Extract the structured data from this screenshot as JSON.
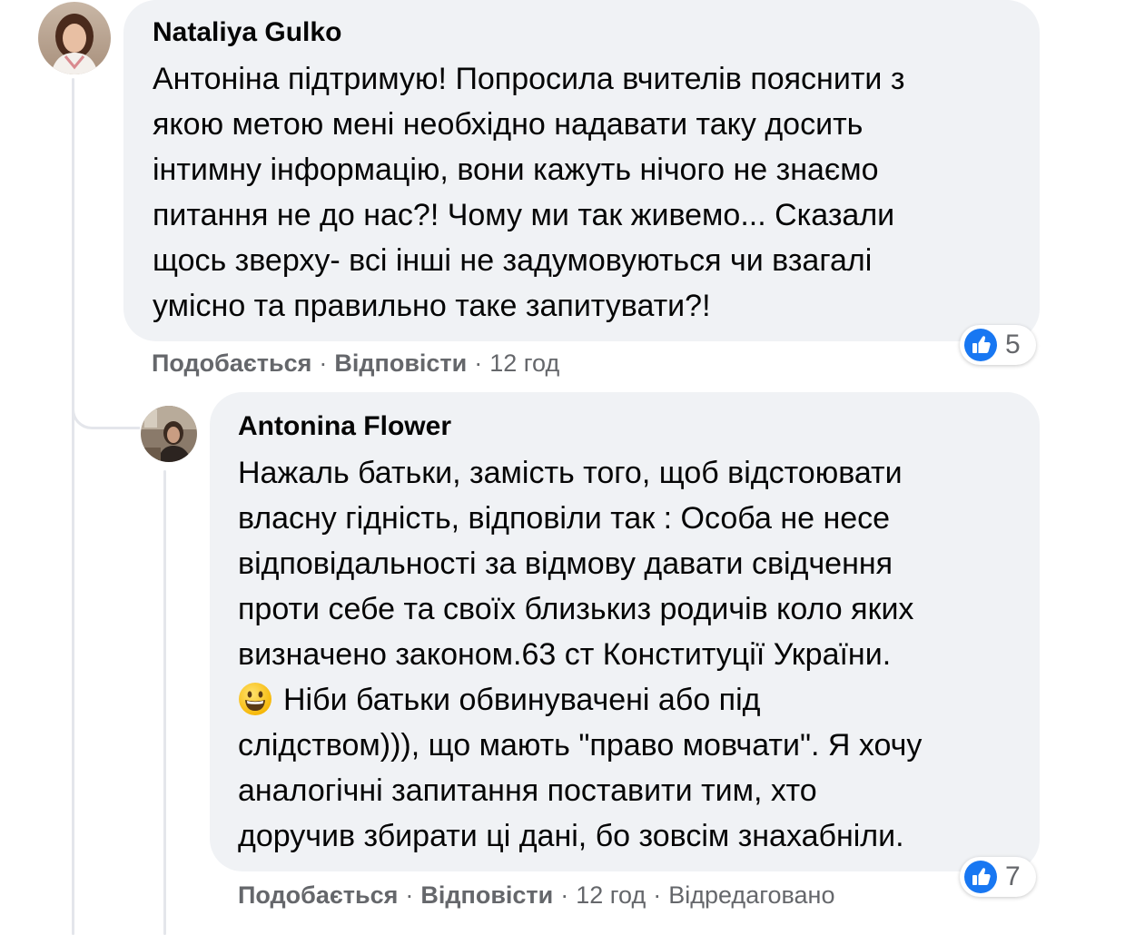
{
  "comments": [
    {
      "author": "Nataliya Gulko",
      "lines": [
        "Антоніна підтримую! Попросила вчителів пояснити з",
        "якою метою мені необхідно надавати таку досить",
        "інтимну інформацію, вони кажуть нічого не знаємо",
        "питання не до нас?! Чому ми так живемо... Сказали",
        "щось зверху- всі інші не задумовуються чи взагалі",
        "умісно та правильно таке запитувати?!"
      ],
      "reaction_icon": "like-icon",
      "reaction_count": "5",
      "actions": {
        "like": "Подобається",
        "reply": "Відповісти",
        "time": "12 год"
      }
    },
    {
      "author": "Antonina Flower",
      "lines": [
        "Нажаль батьки, замість того, щоб відстоювати",
        "власну гідність, відповіли так : Особа не несе",
        "відповідальності за відмову давати свідчення",
        "проти себе та своїх близькиз родичів коло яких",
        "визначено законом.63 ст Конституції України.",
        "Ніби батьки обвинувачені або під",
        "слідством))), що мають \"право мовчати\". Я хочу",
        "аналогічні запитання поставити тим, хто",
        "доручив збирати ці дані, бо зовсім знахабніли."
      ],
      "inline_emoji": "grinning-face-emoji",
      "reaction_icon": "like-icon",
      "reaction_count": "7",
      "actions": {
        "like": "Подобається",
        "reply": "Відповісти",
        "time": "12 год",
        "edited": "Відредаговано"
      }
    }
  ],
  "colors": {
    "bubble": "#f0f2f5",
    "text": "#050505",
    "secondary_text": "#65676b",
    "thread_line": "#e4e6eb",
    "like_blue": "#1877f2"
  }
}
